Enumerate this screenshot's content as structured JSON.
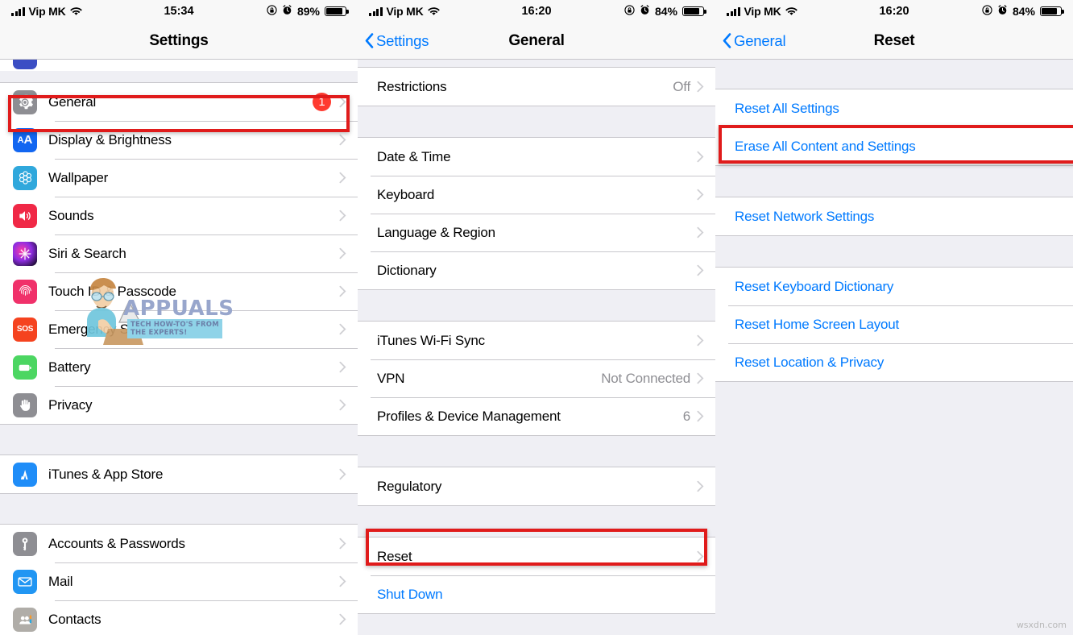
{
  "panels": [
    {
      "id": "settings",
      "statusbar": {
        "carrier": "Vip MK",
        "time": "15:34",
        "battery_pct": "89%",
        "icons": [
          "signal-bars-icon",
          "wifi-icon",
          "rotation-lock-icon",
          "alarm-clock-icon",
          "battery-icon"
        ]
      },
      "nav": {
        "title": "Settings",
        "back_label": null
      },
      "rows": [
        {
          "label": "General",
          "icon": "gear-icon",
          "icon_color": "#8e8e93",
          "badge": "1",
          "value": null,
          "chevron": true,
          "highlight": true
        },
        {
          "label": "Display & Brightness",
          "icon": "aa-text-icon",
          "icon_color": "#1266f1",
          "badge": null,
          "value": null,
          "chevron": true
        },
        {
          "label": "Wallpaper",
          "icon": "flower-icon",
          "icon_color": "#30a8dc",
          "badge": null,
          "value": null,
          "chevron": true
        },
        {
          "label": "Sounds",
          "icon": "speaker-icon",
          "icon_color": "#f02846",
          "badge": null,
          "value": null,
          "chevron": true
        },
        {
          "label": "Siri & Search",
          "icon": "siri-icon",
          "icon_color": "#1a0b2e",
          "badge": null,
          "value": null,
          "chevron": true
        },
        {
          "label": "Touch ID & Passcode",
          "icon": "fingerprint-icon",
          "icon_color": "#f0316a",
          "badge": null,
          "value": null,
          "chevron": true
        },
        {
          "label": "Emergency SOS",
          "icon": "sos-icon",
          "icon_color": "#f5431f",
          "badge": null,
          "value": null,
          "chevron": true
        },
        {
          "label": "Battery",
          "icon": "battery-icon",
          "icon_color": "#4cd662",
          "badge": null,
          "value": null,
          "chevron": true
        },
        {
          "label": "Privacy",
          "icon": "hand-icon",
          "icon_color": "#8e8e93",
          "badge": null,
          "value": null,
          "chevron": true
        },
        {
          "label": "__GAP__"
        },
        {
          "label": "iTunes & App Store",
          "icon": "appstore-icon",
          "icon_color": "#1f8df8",
          "badge": null,
          "value": null,
          "chevron": true
        },
        {
          "label": "__GAP__"
        },
        {
          "label": "Accounts & Passwords",
          "icon": "key-icon",
          "icon_color": "#8e8e93",
          "badge": null,
          "value": null,
          "chevron": true
        },
        {
          "label": "Mail",
          "icon": "mail-icon",
          "icon_color": "#2196f3",
          "badge": null,
          "value": null,
          "chevron": true
        },
        {
          "label": "Contacts",
          "icon": "contacts-icon",
          "icon_color": "#b0ada8",
          "badge": null,
          "value": null,
          "chevron": true
        }
      ]
    },
    {
      "id": "general",
      "statusbar": {
        "carrier": "Vip MK",
        "time": "16:20",
        "battery_pct": "84%",
        "icons": [
          "signal-bars-icon",
          "wifi-icon",
          "rotation-lock-icon",
          "alarm-clock-icon",
          "battery-icon"
        ]
      },
      "nav": {
        "title": "General",
        "back_label": "Settings"
      },
      "rows": [
        {
          "label": "Restrictions",
          "value": "Off",
          "chevron": true
        },
        {
          "label": "__GAP__"
        },
        {
          "label": "Date & Time",
          "value": null,
          "chevron": true
        },
        {
          "label": "Keyboard",
          "value": null,
          "chevron": true
        },
        {
          "label": "Language & Region",
          "value": null,
          "chevron": true
        },
        {
          "label": "Dictionary",
          "value": null,
          "chevron": true
        },
        {
          "label": "__GAP__"
        },
        {
          "label": "iTunes Wi-Fi Sync",
          "value": null,
          "chevron": true
        },
        {
          "label": "VPN",
          "value": "Not Connected",
          "chevron": true
        },
        {
          "label": "Profiles & Device Management",
          "value": "6",
          "chevron": true
        },
        {
          "label": "__GAP__"
        },
        {
          "label": "Regulatory",
          "value": null,
          "chevron": true
        },
        {
          "label": "__GAP__"
        },
        {
          "label": "Reset",
          "value": null,
          "chevron": true,
          "highlight": true
        },
        {
          "label": "Shut Down",
          "value": null,
          "chevron": false,
          "blue": true
        }
      ]
    },
    {
      "id": "reset",
      "statusbar": {
        "carrier": "Vip MK",
        "time": "16:20",
        "battery_pct": "84%",
        "icons": [
          "signal-bars-icon",
          "wifi-icon",
          "rotation-lock-icon",
          "alarm-clock-icon",
          "battery-icon"
        ]
      },
      "nav": {
        "title": "Reset",
        "back_label": "General"
      },
      "rows": [
        {
          "label": "__GAP__"
        },
        {
          "label": "Reset All Settings",
          "blue": true,
          "chevron": false
        },
        {
          "label": "Erase All Content and Settings",
          "blue": true,
          "chevron": false,
          "highlight": true
        },
        {
          "label": "__GAP__"
        },
        {
          "label": "Reset Network Settings",
          "blue": true,
          "chevron": false
        },
        {
          "label": "__GAP__"
        },
        {
          "label": "Reset Keyboard Dictionary",
          "blue": true,
          "chevron": false
        },
        {
          "label": "Reset Home Screen Layout",
          "blue": true,
          "chevron": false
        },
        {
          "label": "Reset Location & Privacy",
          "blue": true,
          "chevron": false
        }
      ]
    }
  ],
  "watermark": {
    "brand": "APPUALS",
    "tagline_line1": "TECH HOW-TO'S FROM",
    "tagline_line2": "THE EXPERTS!",
    "corner": "wsxdn.com"
  },
  "colors": {
    "accent_blue": "#007aff",
    "highlight_red": "#e01b1b",
    "badge_red": "#ff3b30",
    "group_bg": "#efeff4"
  }
}
